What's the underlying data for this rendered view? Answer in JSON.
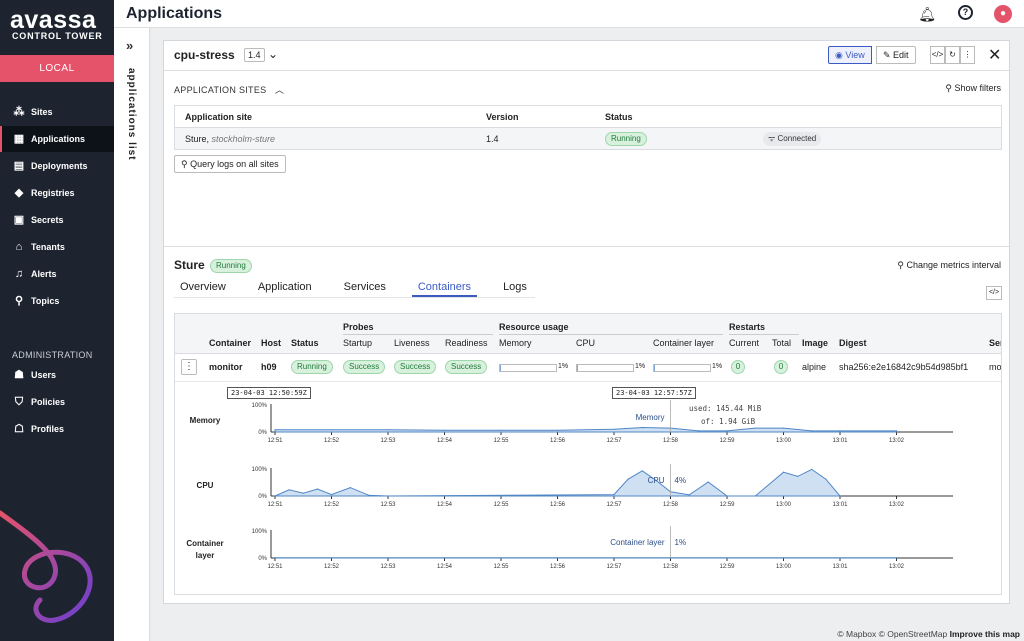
{
  "brand": {
    "logo": "avassa",
    "sub": "CONTROL TOWER",
    "env_button": "LOCAL"
  },
  "nav": {
    "items": [
      {
        "label": "Sites",
        "icon": "sites-icon"
      },
      {
        "label": "Applications",
        "icon": "applications-icon"
      },
      {
        "label": "Deployments",
        "icon": "deployments-icon"
      },
      {
        "label": "Registries",
        "icon": "registries-icon"
      },
      {
        "label": "Secrets",
        "icon": "secrets-icon"
      },
      {
        "label": "Tenants",
        "icon": "tenants-icon"
      },
      {
        "label": "Alerts",
        "icon": "alerts-icon"
      },
      {
        "label": "Topics",
        "icon": "topics-icon"
      }
    ],
    "admin_label": "ADMINISTRATION",
    "admin_items": [
      {
        "label": "Users",
        "icon": "users-icon"
      },
      {
        "label": "Policies",
        "icon": "policies-icon"
      },
      {
        "label": "Profiles",
        "icon": "profiles-icon"
      }
    ],
    "active": "Applications"
  },
  "header": {
    "title": "Applications"
  },
  "side_panel": {
    "label": "applications list"
  },
  "app": {
    "name": "cpu-stress",
    "version": "1.4",
    "view_label": "View",
    "edit_label": "Edit"
  },
  "sites": {
    "section_label": "APPLICATION SITES",
    "show_filters": "Show filters",
    "columns": [
      "Application site",
      "Version",
      "Status",
      ""
    ],
    "rows": [
      {
        "site": "Sture,",
        "site_sub": "stockholm-sture",
        "version": "1.4",
        "status": "Running",
        "connection": "Connected"
      }
    ],
    "query_button": "Query logs on all sites"
  },
  "site_detail": {
    "name": "Sture",
    "status": "Running",
    "change_metrics": "Change metrics interval",
    "tabs": [
      "Overview",
      "Application",
      "Services",
      "Containers",
      "Logs"
    ],
    "active_tab": "Containers"
  },
  "containers": {
    "group_headers": {
      "probes": "Probes",
      "resource": "Resource usage",
      "restarts": "Restarts"
    },
    "columns": {
      "container": "Container",
      "host": "Host",
      "status": "Status",
      "startup": "Startup",
      "liveness": "Liveness",
      "readiness": "Readiness",
      "memory": "Memory",
      "cpu": "CPU",
      "layer": "Container layer",
      "current": "Current",
      "total": "Total",
      "image": "Image",
      "digest": "Digest",
      "ser": "Ser"
    },
    "row": {
      "container": "monitor",
      "host": "h09",
      "status": "Running",
      "startup": "Success",
      "liveness": "Success",
      "readiness": "Success",
      "memory_pct": "1%",
      "memory_fill": 0.01,
      "cpu_pct": "1%",
      "cpu_fill": 0.01,
      "layer_pct": "1%",
      "layer_fill": 0.01,
      "current": "0",
      "total": "0",
      "image": "alpine",
      "digest": "sha256:e2e16842c9b54d985bf1",
      "ser": "mo"
    }
  },
  "metrics": {
    "range_start": "23-04-03 12:50:59Z",
    "cursor": "23-04-03 12:57:57Z",
    "tooltip_used": "used: 145.44 MiB",
    "tooltip_of": "of: 1.94 GiB",
    "time_ticks": [
      "12:51",
      "12:52",
      "12:53",
      "12:54",
      "12:55",
      "12:56",
      "12:57",
      "12:58",
      "12:59",
      "13:00",
      "13:01",
      "13:02"
    ],
    "y_top": "100%",
    "y_bottom": "0%",
    "charts": [
      {
        "label": "Memory",
        "hover_name": "Memory",
        "hover_value": ""
      },
      {
        "label": "CPU",
        "hover_name": "CPU",
        "hover_value": "4%"
      },
      {
        "label": "Container\nlayer",
        "hover_name": "Container layer",
        "hover_value": "1%"
      }
    ]
  },
  "chart_data": [
    {
      "type": "area",
      "title": "Memory",
      "x": [
        "12:51",
        "12:52",
        "12:53",
        "12:54",
        "12:55",
        "12:56",
        "12:57",
        "12:57:30",
        "12:58",
        "12:58:30",
        "12:59",
        "12:59:30",
        "13:00",
        "13:00:30",
        "13:01",
        "13:02"
      ],
      "values": [
        8,
        8,
        8,
        6,
        6,
        6,
        10,
        16,
        14,
        4,
        4,
        14,
        14,
        4,
        4,
        4
      ],
      "ylim": [
        0,
        100
      ]
    },
    {
      "type": "area",
      "title": "CPU",
      "x": [
        "12:51",
        "12:51:15",
        "12:51:30",
        "12:51:45",
        "12:52",
        "12:52:20",
        "12:52:40",
        "12:53",
        "12:57",
        "12:57:15",
        "12:57:30",
        "12:57:45",
        "12:58",
        "12:58:20",
        "12:58:40",
        "12:59",
        "12:59:30",
        "13:00",
        "13:00:15",
        "13:00:30",
        "13:00:45",
        "13:01"
      ],
      "values": [
        0,
        22,
        10,
        25,
        5,
        30,
        2,
        0,
        5,
        60,
        90,
        55,
        15,
        4,
        50,
        0,
        0,
        85,
        70,
        95,
        60,
        0
      ],
      "ylim": [
        0,
        100
      ]
    },
    {
      "type": "area",
      "title": "Container layer",
      "x": [
        "12:51",
        "13:02"
      ],
      "values": [
        1,
        1
      ],
      "ylim": [
        0,
        100
      ]
    }
  ],
  "map": {
    "attribution": "© Mapbox © OpenStreetMap",
    "improve": "Improve this map"
  }
}
